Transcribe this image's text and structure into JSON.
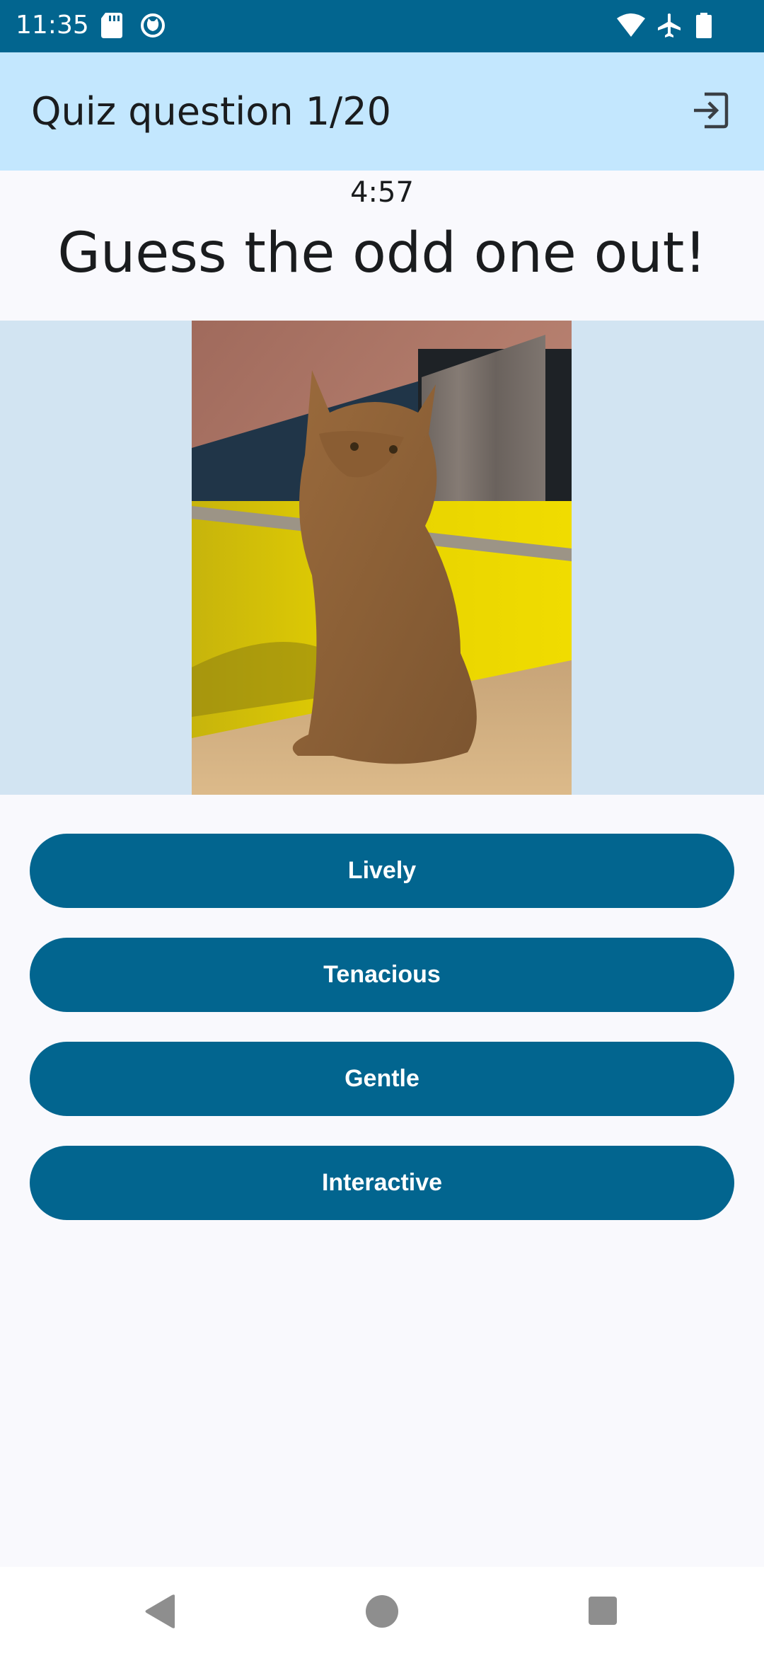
{
  "status_bar": {
    "time": "11:35",
    "left_icons": [
      "sd-card-icon",
      "cat-notification-icon"
    ],
    "right_icons": [
      "wifi-icon",
      "airplane-icon",
      "battery-icon"
    ]
  },
  "app_bar": {
    "title": "Quiz question 1/20",
    "exit_icon": "exit-icon"
  },
  "quiz": {
    "timer": "4:57",
    "question": "Guess the odd one out!",
    "image": "cat-photo",
    "answers": [
      {
        "label": "Lively"
      },
      {
        "label": "Tenacious"
      },
      {
        "label": "Gentle"
      },
      {
        "label": "Interactive"
      }
    ]
  },
  "nav_bar": {
    "icons": [
      "back-icon",
      "home-icon",
      "recents-icon"
    ]
  },
  "colors": {
    "primary": "#02658f",
    "app_bar_bg": "#c3e7fe",
    "image_band_bg": "#d2e4f2",
    "background": "#f9f9fd"
  }
}
